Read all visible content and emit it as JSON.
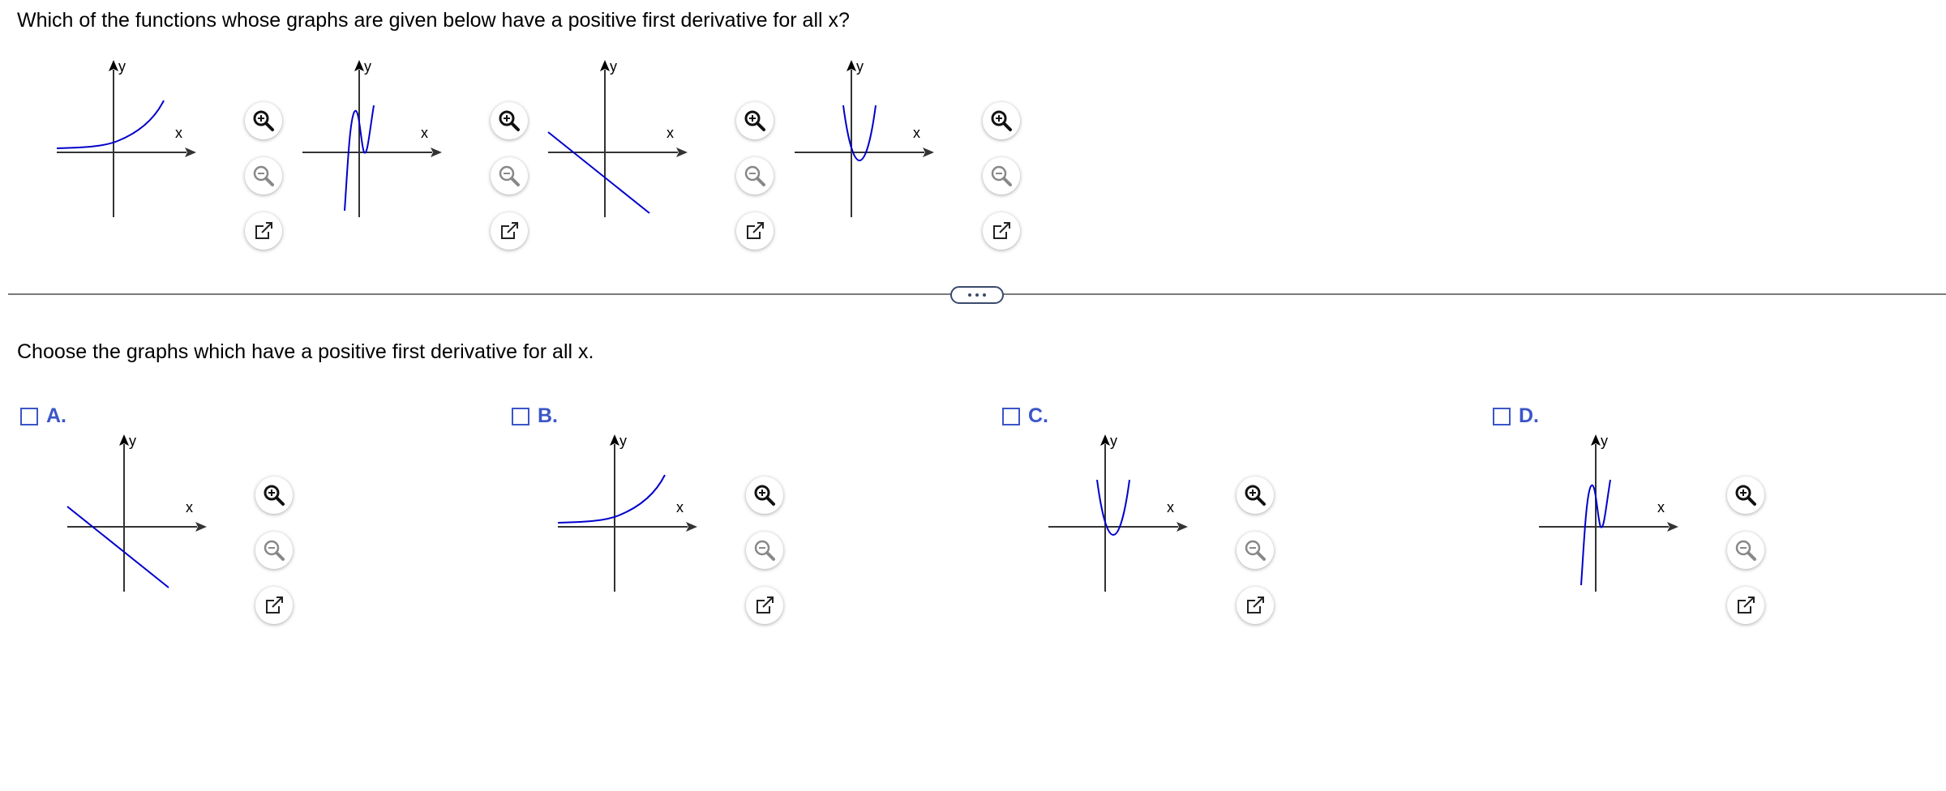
{
  "question": "Which of the functions whose graphs are given below have a positive first derivative for all x?",
  "instruction": "Choose the graphs which have a positive first derivative for all x.",
  "axis_labels": {
    "x": "x",
    "y": "y"
  },
  "colors": {
    "curve": "#0000cc",
    "axis": "#333333",
    "choice_label": "#3b55c8"
  },
  "icons": {
    "zoom_in": "zoom-in-icon",
    "zoom_out": "zoom-out-icon",
    "open": "open-external-icon"
  },
  "top_graphs": [
    {
      "curve": "exponential"
    },
    {
      "curve": "cubic"
    },
    {
      "curve": "decreasing-line"
    },
    {
      "curve": "parabola"
    }
  ],
  "choices": [
    {
      "label": "A.",
      "checked": false,
      "curve": "decreasing-line"
    },
    {
      "label": "B.",
      "checked": false,
      "curve": "exponential"
    },
    {
      "label": "C.",
      "checked": false,
      "curve": "parabola"
    },
    {
      "label": "D.",
      "checked": false,
      "curve": "cubic"
    }
  ],
  "more_button": "..."
}
